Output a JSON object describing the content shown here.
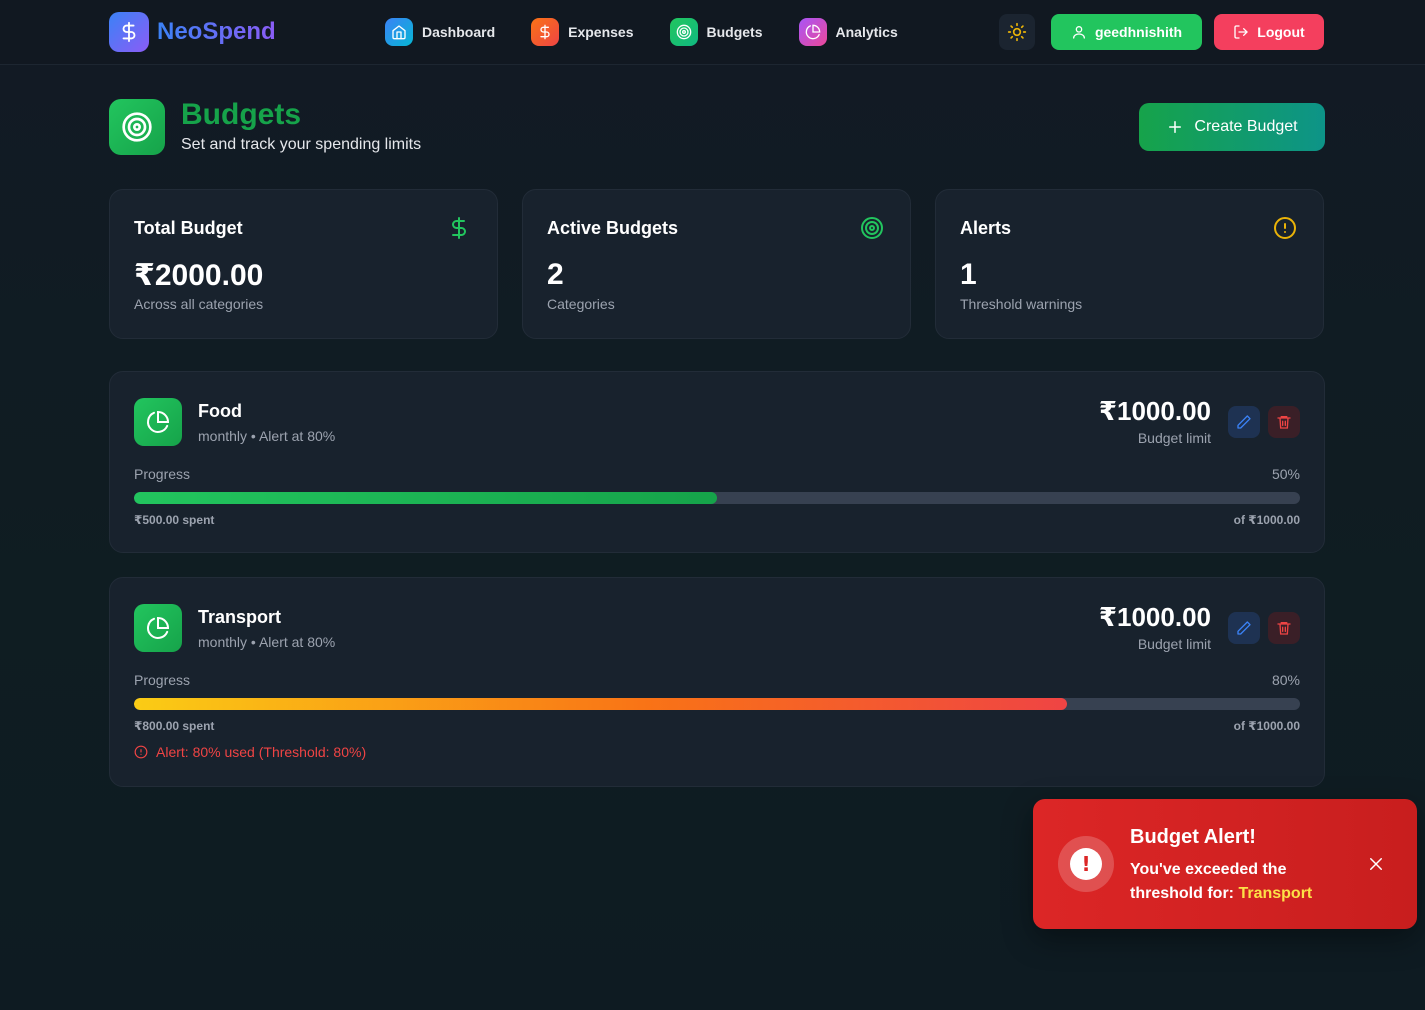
{
  "app": {
    "name": "NeoSpend"
  },
  "nav": {
    "items": [
      {
        "label": "Dashboard",
        "icon": "home-icon",
        "color": "#3b82f6"
      },
      {
        "label": "Expenses",
        "icon": "dollar-icon",
        "color": "#f97316"
      },
      {
        "label": "Budgets",
        "icon": "target-icon",
        "color": "#22c55e"
      },
      {
        "label": "Analytics",
        "icon": "pie-chart-icon",
        "color": "#d946ef"
      }
    ],
    "user": "geedhnishith",
    "logout": "Logout"
  },
  "page": {
    "title": "Budgets",
    "subtitle": "Set and track your spending limits",
    "create_button": "Create Budget"
  },
  "stats": [
    {
      "title": "Total Budget",
      "value": "₹2000.00",
      "sub": "Across all categories",
      "icon": "dollar-icon",
      "color": "#22c55e"
    },
    {
      "title": "Active Budgets",
      "value": "2",
      "sub": "Categories",
      "icon": "target-icon",
      "color": "#22c55e"
    },
    {
      "title": "Alerts",
      "value": "1",
      "sub": "Threshold warnings",
      "icon": "alert-circle-icon",
      "color": "#eab308"
    }
  ],
  "budgets": [
    {
      "name": "Food",
      "period": "monthly",
      "alert_label": "Alert at 80%",
      "amount": "₹1000.00",
      "limit_label": "Budget limit",
      "progress_label": "Progress",
      "percent_text": "50%",
      "progress": 0.5,
      "spent": "₹500.00 spent",
      "of_total": "of ₹1000.00",
      "alert_message": ""
    },
    {
      "name": "Transport",
      "period": "monthly",
      "alert_label": "Alert at 80%",
      "amount": "₹1000.00",
      "limit_label": "Budget limit",
      "progress_label": "Progress",
      "percent_text": "80%",
      "progress": 0.8,
      "spent": "₹800.00 spent",
      "of_total": "of ₹1000.00",
      "alert_message": "Alert: 80% used (Threshold: 80%)"
    }
  ],
  "toast": {
    "title": "Budget Alert!",
    "message": "You've exceeded the threshold for:",
    "highlight": "Transport"
  },
  "colors": {
    "accent_green": "#22c55e",
    "danger": "#ef4444",
    "warning": "#eab308"
  }
}
